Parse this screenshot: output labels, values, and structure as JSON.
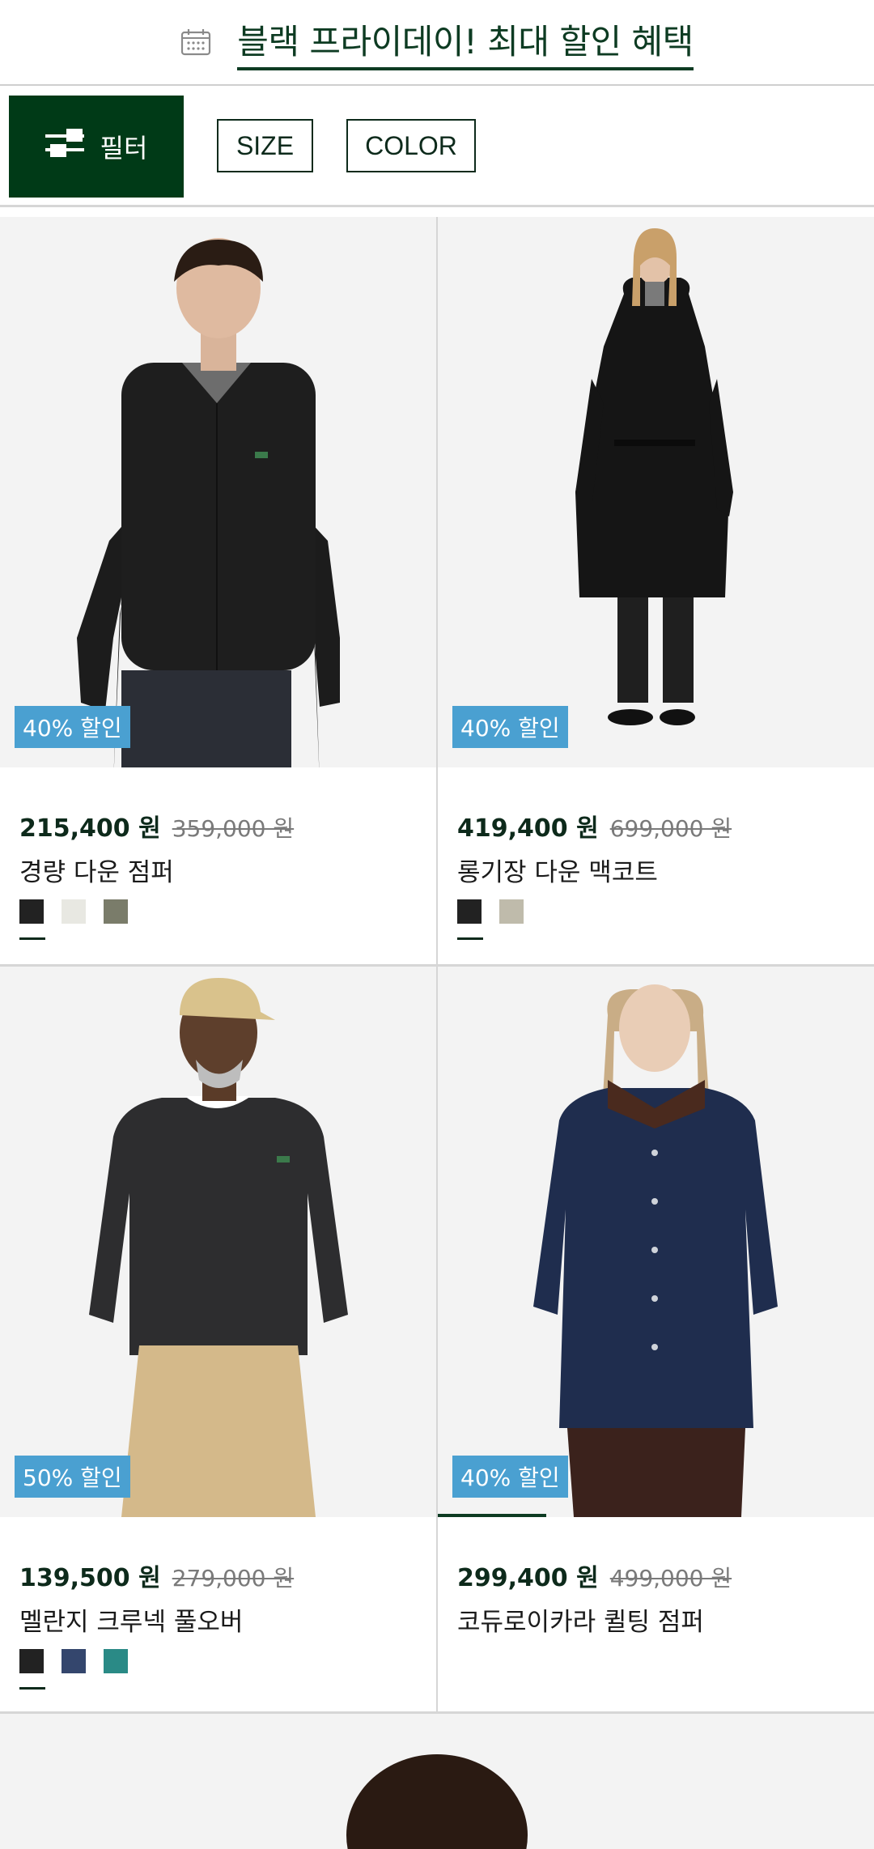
{
  "promo": {
    "text": "블랙 프라이데이! 최대 할인 혜택",
    "icon": "calendar-icon"
  },
  "filters": {
    "filter_label": "필터",
    "chips": [
      "SIZE",
      "COLOR"
    ]
  },
  "colors": {
    "brand_green": "#003a17",
    "badge_blue": "#4aa0d1"
  },
  "products": [
    {
      "badge": "40% 할인",
      "price": "215,400 원",
      "old_price": "359,000 원",
      "name": "경량 다운 점퍼",
      "swatches": [
        "#222222",
        "#e8e8e2",
        "#7a7c6a"
      ]
    },
    {
      "badge": "40% 할인",
      "price": "419,400 원",
      "old_price": "699,000 원",
      "name": "롱기장 다운 맥코트",
      "swatches": [
        "#222222",
        "#bfbbab"
      ]
    },
    {
      "badge": "50% 할인",
      "price": "139,500 원",
      "old_price": "279,000 원",
      "name": "멜란지 크루넥 풀오버",
      "swatches": [
        "#222222",
        "#34466d",
        "#2a8a86"
      ]
    },
    {
      "badge": "40% 할인",
      "price": "299,400 원",
      "old_price": "499,000 원",
      "name": "코듀로이카라 퀼팅 점퍼",
      "swatches": []
    }
  ]
}
